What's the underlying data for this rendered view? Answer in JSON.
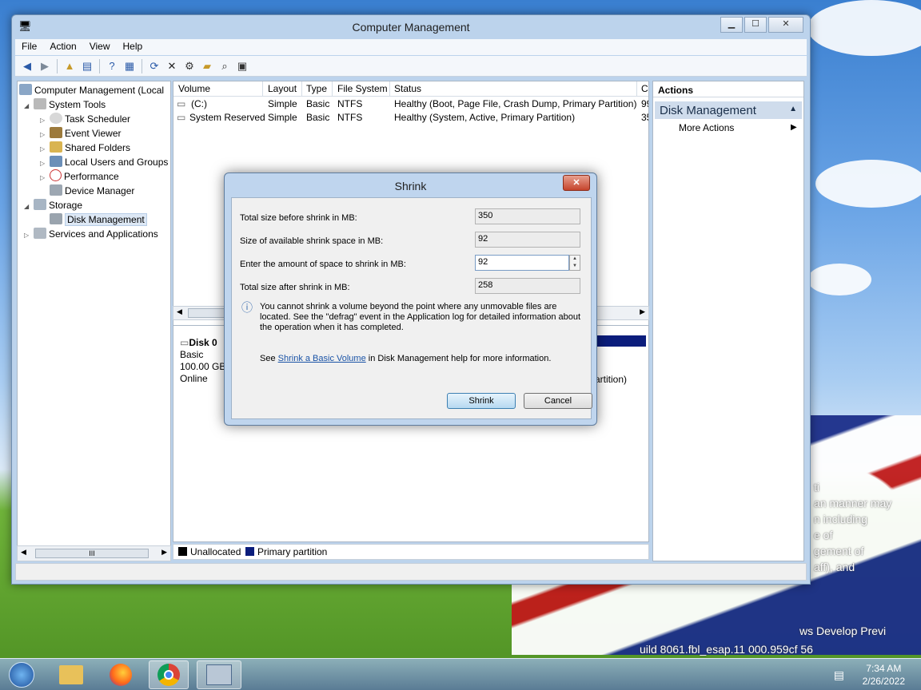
{
  "window": {
    "title": "Computer Management",
    "menu": [
      "File",
      "Action",
      "View",
      "Help"
    ]
  },
  "tree": {
    "root": "Computer Management (Local",
    "items": [
      {
        "label": "System Tools",
        "level": 1,
        "expanded": true
      },
      {
        "label": "Task Scheduler",
        "level": 2
      },
      {
        "label": "Event Viewer",
        "level": 2
      },
      {
        "label": "Shared Folders",
        "level": 2
      },
      {
        "label": "Local Users and Groups",
        "level": 2
      },
      {
        "label": "Performance",
        "level": 2
      },
      {
        "label": "Device Manager",
        "level": 2
      },
      {
        "label": "Storage",
        "level": 1,
        "expanded": true
      },
      {
        "label": "Disk Management",
        "level": 2,
        "selected": true
      },
      {
        "label": "Services and Applications",
        "level": 1
      }
    ],
    "scroll_thumb": "III"
  },
  "volumes": {
    "columns": [
      "Volume",
      "Layout",
      "Type",
      "File System",
      "Status",
      "C"
    ],
    "rows": [
      {
        "volume": "(C:)",
        "layout": "Simple",
        "type": "Basic",
        "fs": "NTFS",
        "status": "Healthy (Boot, Page File, Crash Dump, Primary Partition)",
        "c": "99"
      },
      {
        "volume": "System Reserved",
        "layout": "Simple",
        "type": "Basic",
        "fs": "NTFS",
        "status": "Healthy (System, Active, Primary Partition)",
        "c": "35"
      }
    ]
  },
  "disk": {
    "name": "Disk 0",
    "type": "Basic",
    "size": "100.00 GB",
    "state": "Online",
    "partition_tail": "artition)"
  },
  "legend": {
    "unallocated": "Unallocated",
    "primary": "Primary partition",
    "unallocated_color": "#000000",
    "primary_color": "#0b1d7c"
  },
  "actions": {
    "header": "Actions",
    "section": "Disk Management",
    "more": "More Actions"
  },
  "dialog": {
    "title": "Shrink",
    "fields": [
      {
        "label": "Total size before shrink in MB:",
        "value": "350"
      },
      {
        "label": "Size of available shrink space in MB:",
        "value": "92"
      },
      {
        "label": "Enter the amount of space to shrink in MB:",
        "value": "92"
      },
      {
        "label": "Total size after shrink in MB:",
        "value": "258"
      }
    ],
    "info": "You cannot shrink a volume beyond the point where any unmovable files are located. See the \"defrag\" event in the Application log for detailed information about the operation when it has completed.",
    "see_prefix": "See ",
    "see_link": "Shrink a Basic Volume",
    "see_suffix": " in Disk Management help for more information.",
    "shrink_button": "Shrink",
    "cancel_button": "Cancel"
  },
  "taskbar": {
    "time": "7:34 AM",
    "date": "2/26/2022"
  },
  "desktop": {
    "watermark1": "ws Develop    Previ",
    "watermark2": "uild 8061.fbl_esap.11    000.959cf    56",
    "side_text": [
      "ti",
      "an  manner may",
      "n including",
      "e of",
      "gement of",
      "aff), and"
    ]
  }
}
